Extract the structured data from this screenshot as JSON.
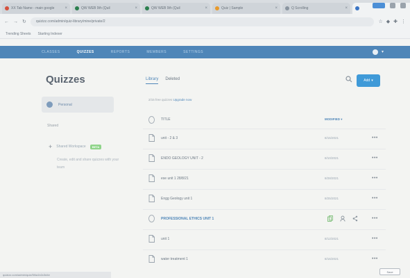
{
  "browser": {
    "tabs": [
      {
        "label": "XX Tab Name - main google",
        "fav": "#d4513d",
        "active": false
      },
      {
        "label": "QW WEB 9th (Quil",
        "fav": "#2c7f4e",
        "active": false
      },
      {
        "label": "QW WEB 9th (Quil",
        "fav": "#2c7f4e",
        "active": false
      },
      {
        "label": "Quiz | Sample",
        "fav": "#e89a2c",
        "active": false
      },
      {
        "label": "Q Scrolling",
        "fav": "#8a95a0",
        "active": false
      },
      {
        "label": "",
        "fav": "#3b75c4",
        "active": true
      }
    ],
    "new_tab": "+",
    "url": "quizizz.com/admin/quiz-library/mine/private/2",
    "bookmarks": [
      "Trending Sheets",
      "Starting Indexer"
    ]
  },
  "app": {
    "nav": [
      "CLASSES",
      "QUIZZES",
      "REPORTS",
      "MEMBERS",
      "SETTINGS"
    ],
    "active_nav": 1
  },
  "sidebar": {
    "title": "Quizzes",
    "personal": "Personal",
    "shared_label": "Shared",
    "shared_workspace": "Shared Workspace",
    "beta": "BETA",
    "shared_desc": "Create, edit and share quizzes with your team"
  },
  "main": {
    "tabs": [
      "Library",
      "Deleted"
    ],
    "add_label": "Add",
    "quota_text": "2/15 free quizzes",
    "quota_link": "Upgrade now",
    "header": {
      "name": "TITLE",
      "modified": "MODIFIED"
    },
    "rows": [
      {
        "name": "unit - 2 & 3",
        "date": "8/15/2021",
        "icon": "document",
        "selected": false
      },
      {
        "name": "ENDO GEOLOGY UNIT - 2",
        "date": "8/10/2021",
        "icon": "document",
        "selected": false
      },
      {
        "name": "ese unit 1 28/8/21",
        "date": "8/28/2021",
        "icon": "document",
        "selected": false
      },
      {
        "name": "Engg Geology unit 1",
        "date": "8/25/2021",
        "icon": "document",
        "selected": false
      },
      {
        "name": "PROFESSIONAL ETHICS UNIT 1",
        "date": "",
        "icon": "circle",
        "selected": true
      },
      {
        "name": "unit 1",
        "date": "8/12/2021",
        "icon": "document",
        "selected": false
      },
      {
        "name": "water treatment 1",
        "date": "8/16/2021",
        "icon": "document",
        "selected": false
      }
    ],
    "more": "•••"
  },
  "status": {
    "url": "quizizz.com/admin/quiz/5f4a1b2c3d4e",
    "corner": "Save"
  }
}
